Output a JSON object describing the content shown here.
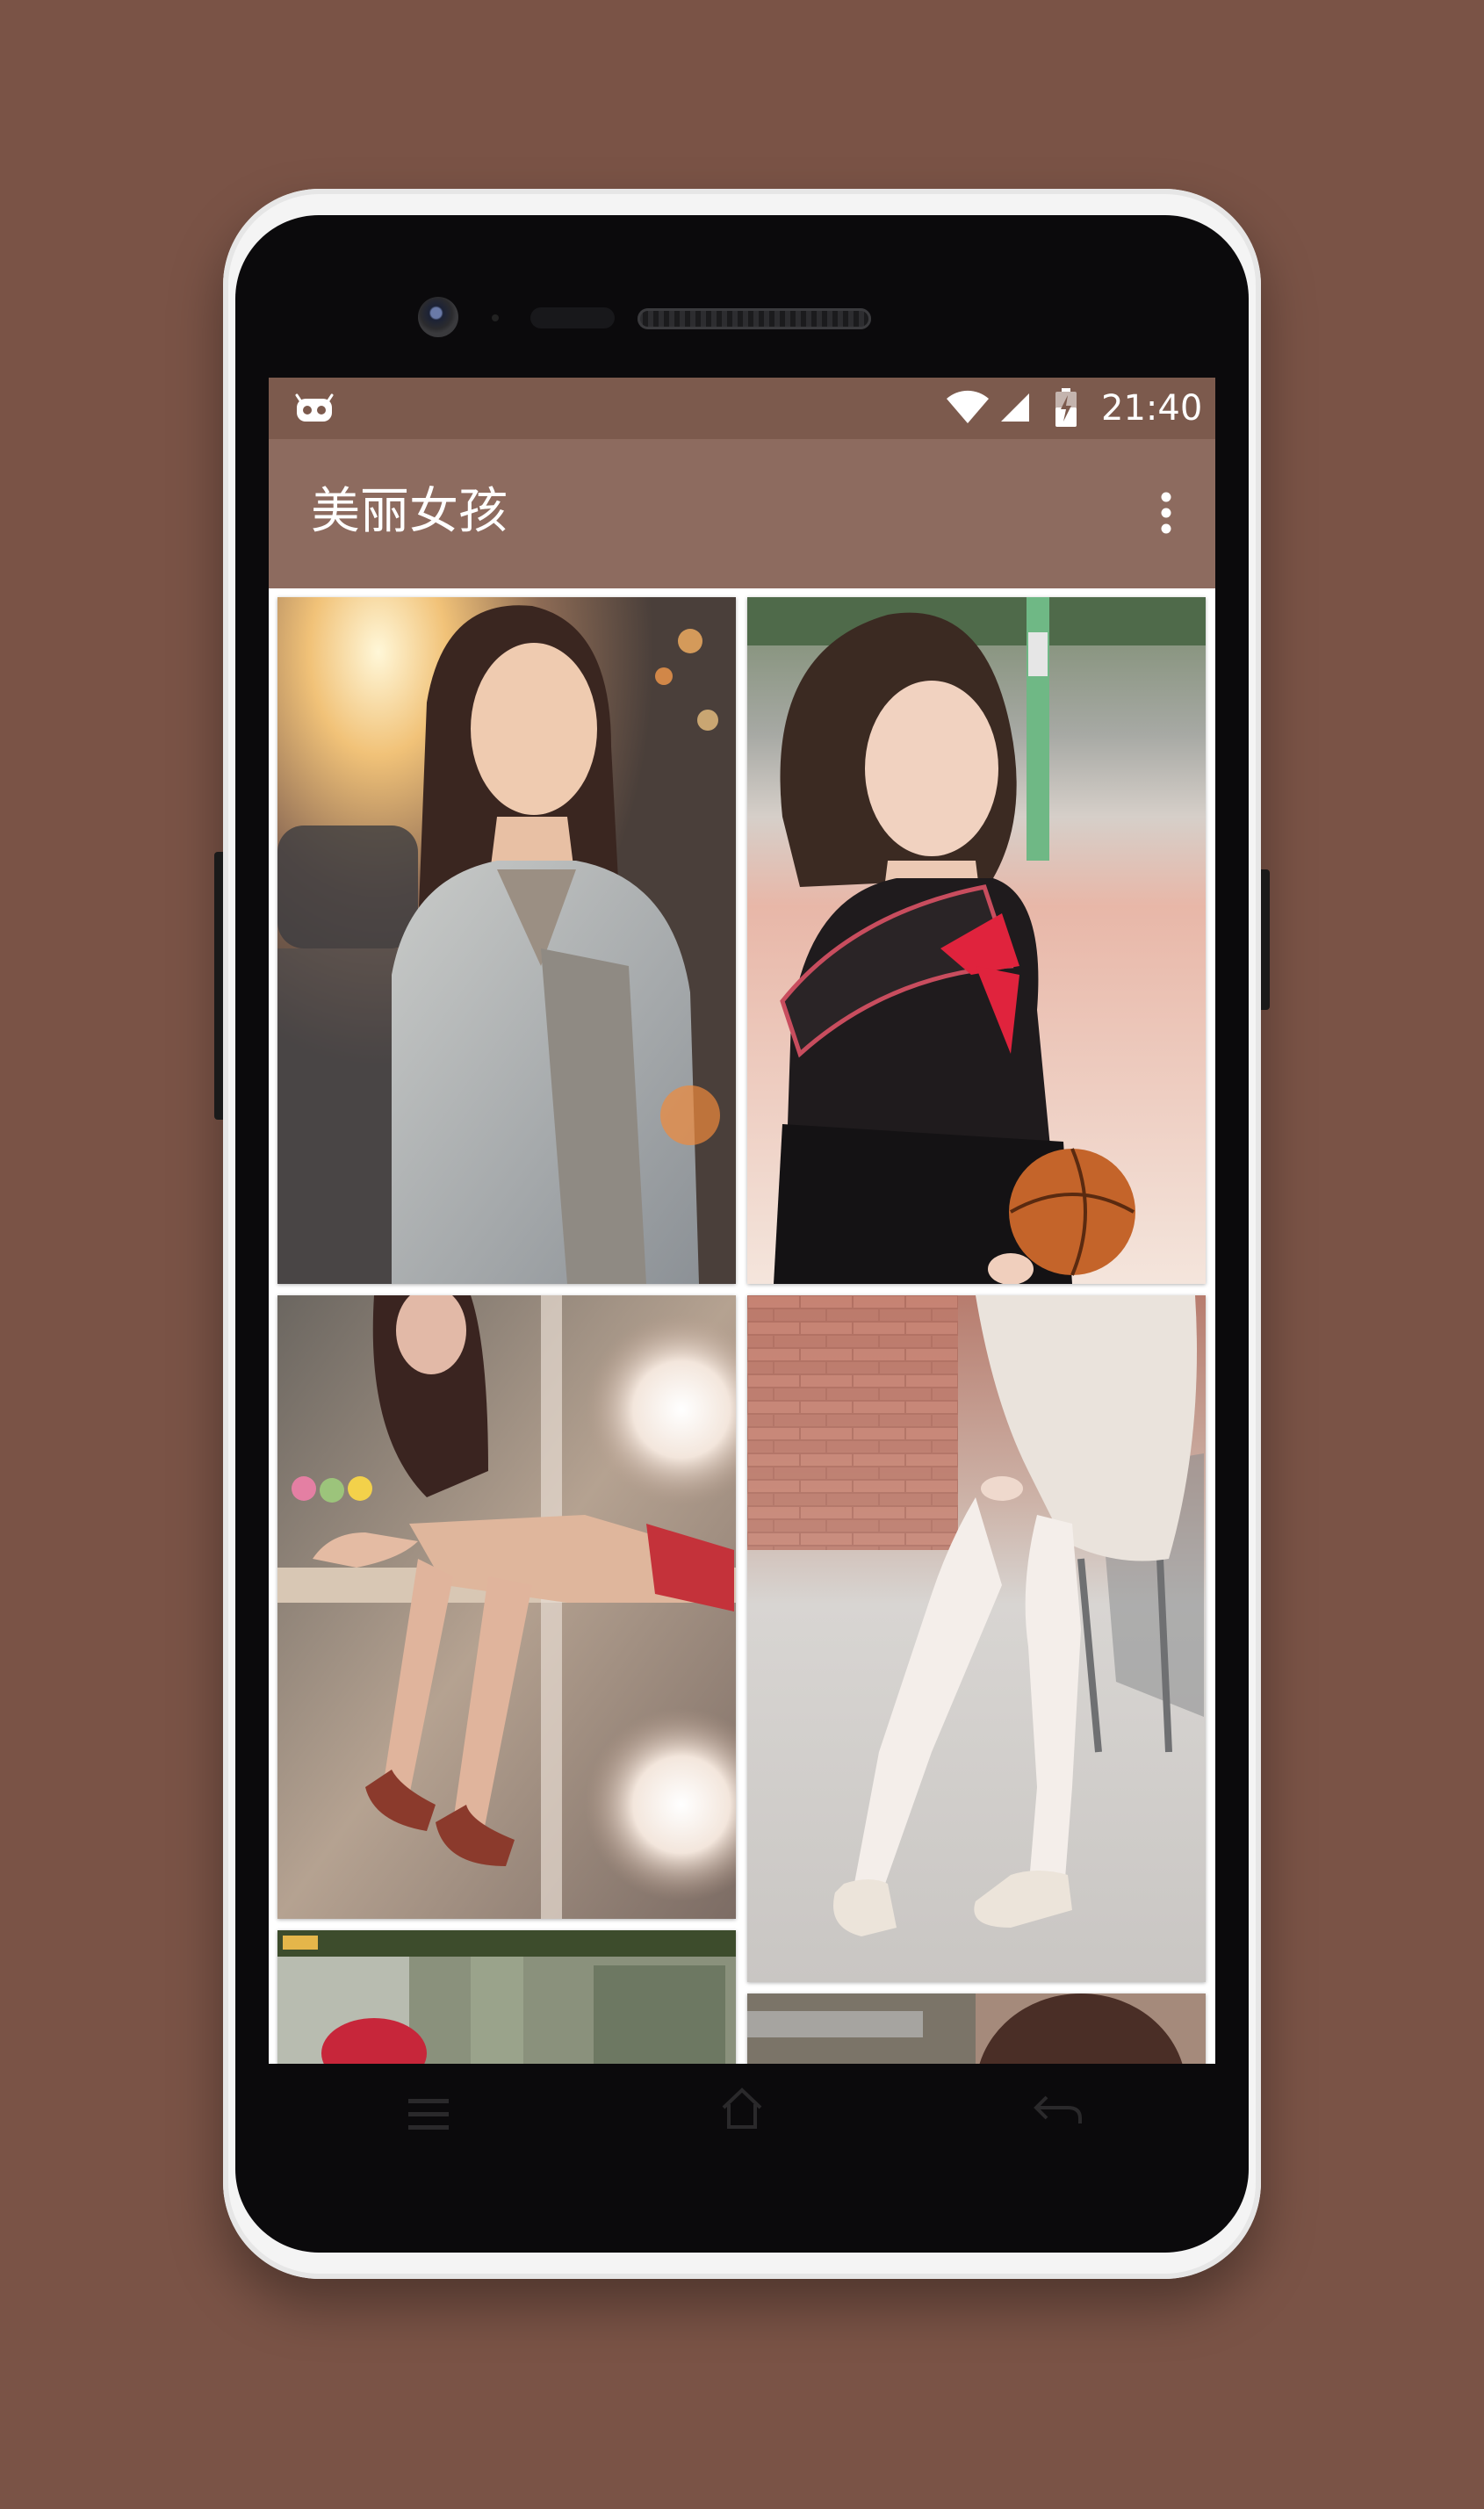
{
  "status_bar": {
    "time": "21:40",
    "icons": [
      "android-robot-icon",
      "wifi-icon",
      "signal-icon",
      "battery-charging-icon"
    ]
  },
  "toolbar": {
    "title": "美丽女孩",
    "overflow_icon": "more-vert-icon"
  },
  "gallery": {
    "photos": [
      {
        "description_icon": "photo-girl-denim-jacket"
      },
      {
        "description_icon": "photo-girl-sailor-uniform"
      },
      {
        "description_icon": "photo-girl-red-heels"
      },
      {
        "description_icon": "photo-girl-white-stockings"
      },
      {
        "description_icon": "photo-partial-bottom-left"
      },
      {
        "description_icon": "photo-partial-bottom-right"
      }
    ]
  },
  "colors": {
    "background": "#7a5346",
    "status_bar": "#7c5a4d",
    "toolbar": "#8d6b5f"
  },
  "nav_bar": {
    "icons": [
      "menu-icon",
      "home-icon",
      "back-icon"
    ]
  }
}
